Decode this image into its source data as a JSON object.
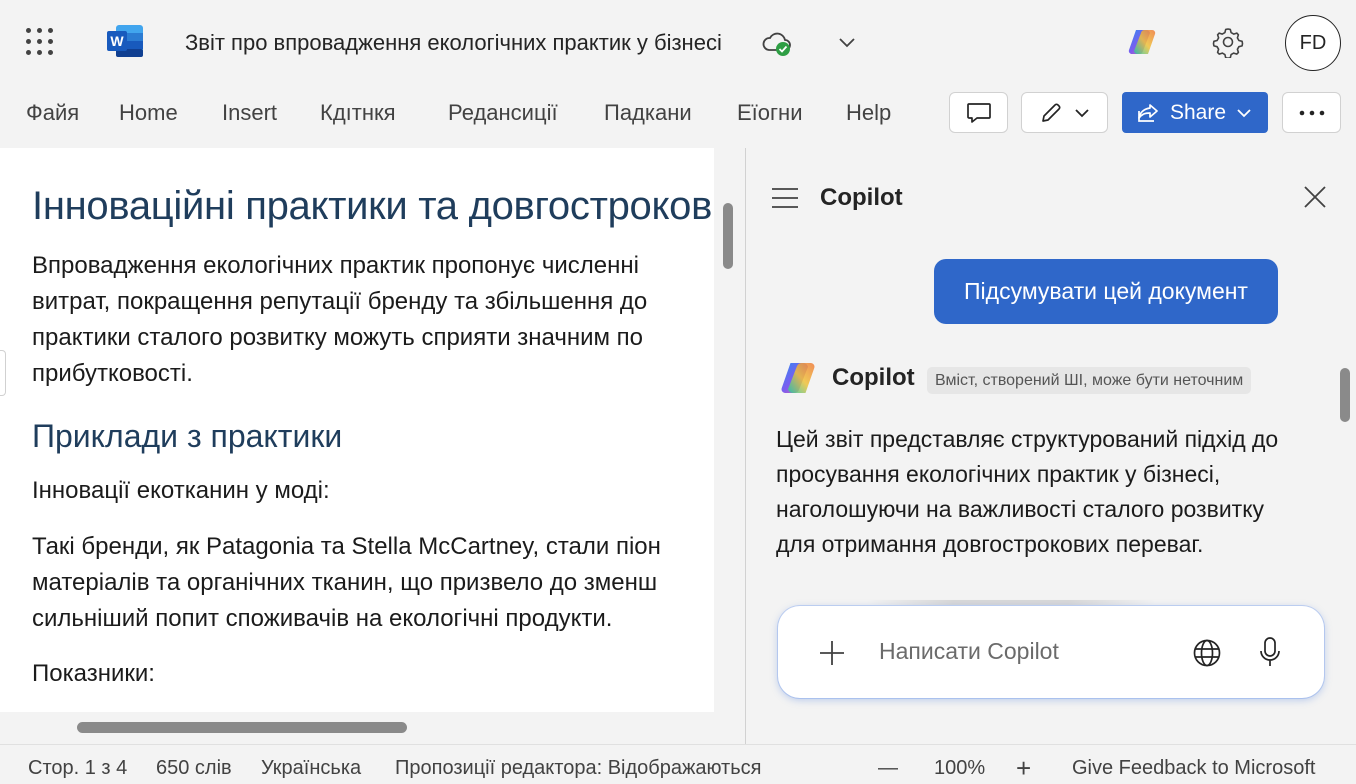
{
  "titlebar": {
    "doc_title": "Звіт про впровадження екологічних практик у бізнесі",
    "avatar_initials": "FD"
  },
  "ribbon": {
    "tabs": [
      "Файя",
      "Home",
      "Insert",
      "Кдıтнкя",
      "Редансиції",
      "Падкани",
      "Еїогни",
      "Help"
    ],
    "share_label": "Share"
  },
  "document": {
    "heading1": "Інноваційні практики та довгострокові",
    "para1": [
      "Впровадження екологічних практик пропонує численні",
      "витрат, покращення репутації бренду та збільшення до",
      "практики сталого розвитку можуть сприяти значним по",
      "прибутковості."
    ],
    "heading2": "Приклади з практики",
    "para2": "Інновації екотканин у моді:",
    "para3": [
      "Такі бренди, як Patagonia та Stella McCartney, стали піон",
      "матеріалів та органічних тканин, що призвело до зменш",
      "сильніший попит споживачів на екологічні продукти."
    ],
    "para4": "Показники:"
  },
  "copilot": {
    "title": "Copilot",
    "prompt": "Підсумувати цей документ",
    "assistant_name": "Copilot",
    "ai_badge": "Вміст, створений ШІ, може бути неточним",
    "response_lines": [
      "Цей звіт представляє структурований підхід до",
      "просування екологічних практик у бізнесі,",
      "наголошуючи на важливості сталого розвитку",
      "для отримання довгострокових переваг."
    ],
    "composer_placeholder": "Написати Copilot"
  },
  "statusbar": {
    "page": "Стор. 1 з 4",
    "words": "650 слів",
    "language": "Українська",
    "editor": "Пропозиції редактора: Відображаються",
    "zoom_out": "—",
    "zoom": "100%",
    "zoom_in": "+",
    "feedback": "Give Feedback to Microsoft"
  },
  "colors": {
    "accent": "#2f67c9",
    "heading": "#1f3d5c",
    "word_blue": "#185abd",
    "sync_green": "#2e9e44"
  },
  "icons": [
    "app-launcher-icon",
    "word-logo-icon",
    "cloud-synced-icon",
    "chevron-down-icon",
    "copilot-icon",
    "gear-icon",
    "comment-icon",
    "pencil-icon",
    "share-icon",
    "more-icon",
    "menu-icon",
    "close-icon",
    "plus-icon",
    "globe-icon",
    "mic-icon"
  ]
}
